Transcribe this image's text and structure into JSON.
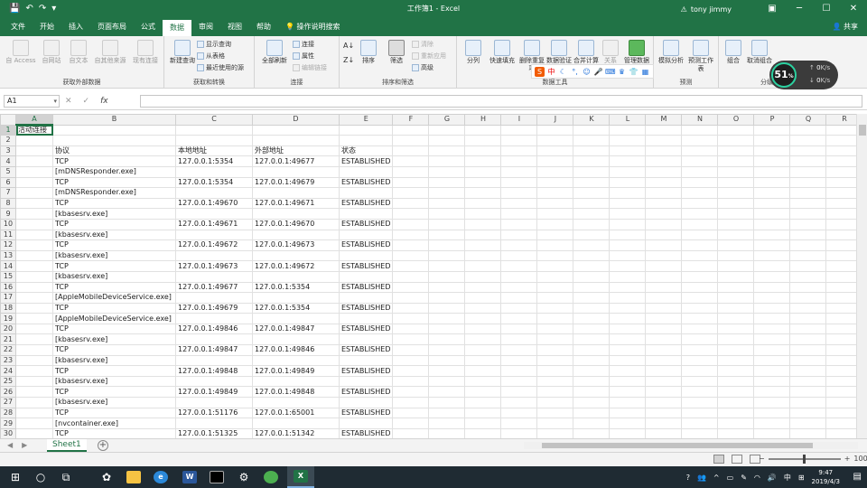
{
  "window": {
    "title": "工作簿1 - Excel",
    "user": "tony jimmy",
    "share": "共享",
    "tell_me": "操作说明搜索"
  },
  "tabs": [
    "文件",
    "开始",
    "插入",
    "页面布局",
    "公式",
    "数据",
    "审阅",
    "视图",
    "帮助"
  ],
  "ribbon": {
    "get_external": {
      "label": "获取外部数据",
      "buttons": [
        "自 Access",
        "自网站",
        "自文本",
        "自其他来源",
        "现有连接"
      ]
    },
    "get_transform": {
      "label": "获取和转换",
      "new_query": "新建查询",
      "show_query": "显示查询",
      "from_table": "从表格",
      "recent_sources": "最近使用的源"
    },
    "connections": {
      "label": "连接",
      "refresh_all": "全部刷新",
      "connections": "连接",
      "properties": "属性",
      "edit_links": "编辑链接"
    },
    "sort_filter": {
      "label": "排序和筛选",
      "sort": "排序",
      "filter": "筛选",
      "clear": "清除",
      "reapply": "重新应用",
      "advanced": "高级"
    },
    "data_tools": {
      "label": "数据工具",
      "text_to_columns": "分列",
      "flash_fill": "快速填充",
      "remove_dup": "删除重复项",
      "validation": "数据验证",
      "consolidate": "合并计算",
      "relationships": "关系",
      "manage_model": "管理数据模型"
    },
    "forecast": {
      "label": "预测",
      "what_if": "模拟分析",
      "forecast_sheet": "预测工作表"
    },
    "outline": {
      "label": "分级显示",
      "group": "组合",
      "ungroup": "取消组合"
    }
  },
  "ime": {
    "logo": "S",
    "mode": "中"
  },
  "gauge": {
    "percent": "51",
    "unit": "%",
    "up": "0",
    "down": "0",
    "speed_unit": "K/s"
  },
  "formula_bar": {
    "name_box": "A1",
    "fx": "fx",
    "cancel": "✕",
    "enter": "✓"
  },
  "columns": [
    "A",
    "B",
    "C",
    "D",
    "E",
    "F",
    "G",
    "H",
    "I",
    "J",
    "K",
    "L",
    "M",
    "N",
    "O",
    "P",
    "Q",
    "R"
  ],
  "rows": [
    {
      "n": "1",
      "a": "活动连接",
      "b": "",
      "c": "",
      "d": "",
      "e": ""
    },
    {
      "n": "2",
      "a": "",
      "b": "",
      "c": "",
      "d": "",
      "e": ""
    },
    {
      "n": "3",
      "a": "",
      "b": "协议",
      "c": "本地地址",
      "d": "外部地址",
      "e": "状态"
    },
    {
      "n": "4",
      "a": "",
      "b": "TCP",
      "c": "127.0.0.1:5354",
      "d": "127.0.0.1:49677",
      "e": "ESTABLISHED"
    },
    {
      "n": "5",
      "a": "",
      "b": "[mDNSResponder.exe]",
      "c": "",
      "d": "",
      "e": ""
    },
    {
      "n": "6",
      "a": "",
      "b": "TCP",
      "c": "127.0.0.1:5354",
      "d": "127.0.0.1:49679",
      "e": "ESTABLISHED"
    },
    {
      "n": "7",
      "a": "",
      "b": "[mDNSResponder.exe]",
      "c": "",
      "d": "",
      "e": ""
    },
    {
      "n": "8",
      "a": "",
      "b": "TCP",
      "c": "127.0.0.1:49670",
      "d": "127.0.0.1:49671",
      "e": "ESTABLISHED"
    },
    {
      "n": "9",
      "a": "",
      "b": "[kbasesrv.exe]",
      "c": "",
      "d": "",
      "e": ""
    },
    {
      "n": "10",
      "a": "",
      "b": "TCP",
      "c": "127.0.0.1:49671",
      "d": "127.0.0.1:49670",
      "e": "ESTABLISHED"
    },
    {
      "n": "11",
      "a": "",
      "b": "[kbasesrv.exe]",
      "c": "",
      "d": "",
      "e": ""
    },
    {
      "n": "12",
      "a": "",
      "b": "TCP",
      "c": "127.0.0.1:49672",
      "d": "127.0.0.1:49673",
      "e": "ESTABLISHED"
    },
    {
      "n": "13",
      "a": "",
      "b": "[kbasesrv.exe]",
      "c": "",
      "d": "",
      "e": ""
    },
    {
      "n": "14",
      "a": "",
      "b": "TCP",
      "c": "127.0.0.1:49673",
      "d": "127.0.0.1:49672",
      "e": "ESTABLISHED"
    },
    {
      "n": "15",
      "a": "",
      "b": "[kbasesrv.exe]",
      "c": "",
      "d": "",
      "e": ""
    },
    {
      "n": "16",
      "a": "",
      "b": "TCP",
      "c": "127.0.0.1:49677",
      "d": "127.0.0.1:5354",
      "e": "ESTABLISHED"
    },
    {
      "n": "17",
      "a": "",
      "b": "[AppleMobileDeviceService.exe]",
      "c": "",
      "d": "",
      "e": ""
    },
    {
      "n": "18",
      "a": "",
      "b": "TCP",
      "c": "127.0.0.1:49679",
      "d": "127.0.0.1:5354",
      "e": "ESTABLISHED"
    },
    {
      "n": "19",
      "a": "",
      "b": "[AppleMobileDeviceService.exe]",
      "c": "",
      "d": "",
      "e": ""
    },
    {
      "n": "20",
      "a": "",
      "b": "TCP",
      "c": "127.0.0.1:49846",
      "d": "127.0.0.1:49847",
      "e": "ESTABLISHED"
    },
    {
      "n": "21",
      "a": "",
      "b": "[kbasesrv.exe]",
      "c": "",
      "d": "",
      "e": ""
    },
    {
      "n": "22",
      "a": "",
      "b": "TCP",
      "c": "127.0.0.1:49847",
      "d": "127.0.0.1:49846",
      "e": "ESTABLISHED"
    },
    {
      "n": "23",
      "a": "",
      "b": "[kbasesrv.exe]",
      "c": "",
      "d": "",
      "e": ""
    },
    {
      "n": "24",
      "a": "",
      "b": "TCP",
      "c": "127.0.0.1:49848",
      "d": "127.0.0.1:49849",
      "e": "ESTABLISHED"
    },
    {
      "n": "25",
      "a": "",
      "b": "[kbasesrv.exe]",
      "c": "",
      "d": "",
      "e": ""
    },
    {
      "n": "26",
      "a": "",
      "b": "TCP",
      "c": "127.0.0.1:49849",
      "d": "127.0.0.1:49848",
      "e": "ESTABLISHED"
    },
    {
      "n": "27",
      "a": "",
      "b": "[kbasesrv.exe]",
      "c": "",
      "d": "",
      "e": ""
    },
    {
      "n": "28",
      "a": "",
      "b": "TCP",
      "c": "127.0.0.1:51176",
      "d": "127.0.0.1:65001",
      "e": "ESTABLISHED"
    },
    {
      "n": "29",
      "a": "",
      "b": "[nvcontainer.exe]",
      "c": "",
      "d": "",
      "e": ""
    },
    {
      "n": "30",
      "a": "",
      "b": "TCP",
      "c": "127.0.0.1:51325",
      "d": "127.0.0.1:51342",
      "e": "ESTABLISHED"
    }
  ],
  "sheets": [
    "Sheet1"
  ],
  "status": {
    "zoom": "100%"
  },
  "taskbar": {
    "time": "9:47",
    "date": "2019/4/3",
    "ime_lang": "中"
  },
  "colors": {
    "accent": "#217346",
    "selection": "#217346"
  }
}
